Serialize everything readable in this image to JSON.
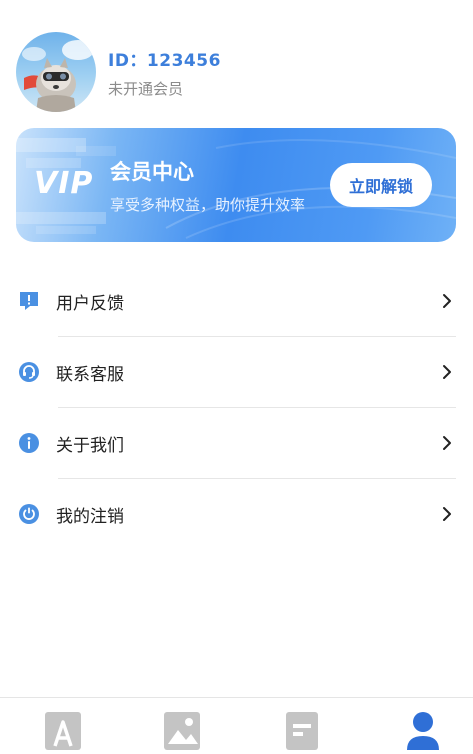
{
  "profile": {
    "id_text": "ID：123456",
    "membership_status": "未开通会员"
  },
  "vip_card": {
    "logo_text": "VIP",
    "title": "会员中心",
    "subtitle": "享受多种权益，助你提升效率",
    "unlock_label": "立即解锁"
  },
  "menu": {
    "items": [
      {
        "label": "用户反馈",
        "icon": "feedback-icon"
      },
      {
        "label": "联系客服",
        "icon": "headset-icon"
      },
      {
        "label": "关于我们",
        "icon": "info-icon"
      },
      {
        "label": "我的注销",
        "icon": "power-icon"
      }
    ]
  },
  "tabbar": {
    "tabs": [
      {
        "icon": "text-icon",
        "active": false
      },
      {
        "icon": "image-icon",
        "active": false
      },
      {
        "icon": "document-icon",
        "active": false
      },
      {
        "icon": "user-icon",
        "active": true
      }
    ]
  },
  "colors": {
    "accent": "#3d7fdb",
    "vip_gradient_start": "#c9e2fb",
    "vip_gradient_mid": "#3e8cf0",
    "icon_blue": "#4a90e2",
    "tab_inactive": "#c4c4c4",
    "tab_active": "#2f6fd6"
  }
}
